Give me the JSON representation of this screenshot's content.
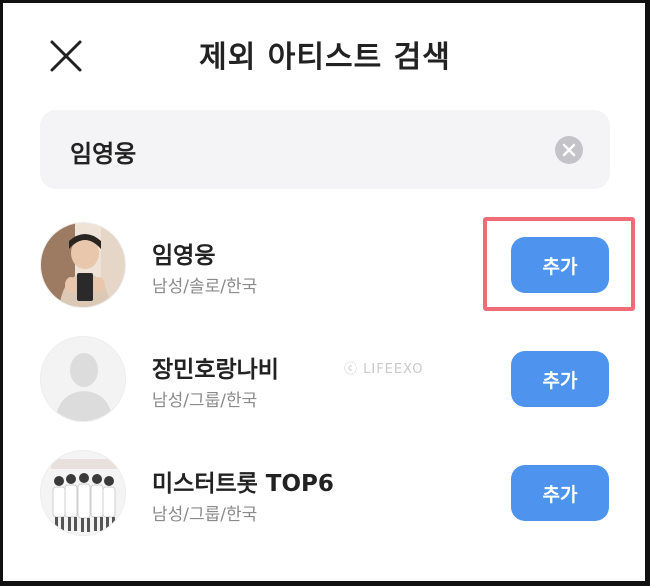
{
  "header": {
    "title": "제외 아티스트 검색",
    "close_icon": "close-icon"
  },
  "search": {
    "value": "임영웅",
    "clear_icon": "clear-circle-icon"
  },
  "results": [
    {
      "name": "임영웅",
      "meta": "남성/솔로/한국",
      "button": "추가",
      "avatar": "artist-photo"
    },
    {
      "name": "장민호랑나비",
      "meta": "남성/그룹/한국",
      "button": "추가",
      "avatar": "default-profile"
    },
    {
      "name": "미스터트롯 TOP6",
      "meta": "남성/그룹/한국",
      "button": "추가",
      "avatar": "group-photo"
    }
  ],
  "watermark": "ⓒ LIFEEXO",
  "colors": {
    "accent": "#4e94ee",
    "highlight": "#ef6b78",
    "search_bg": "#f4f4f6",
    "meta_text": "#8a8a8a"
  }
}
